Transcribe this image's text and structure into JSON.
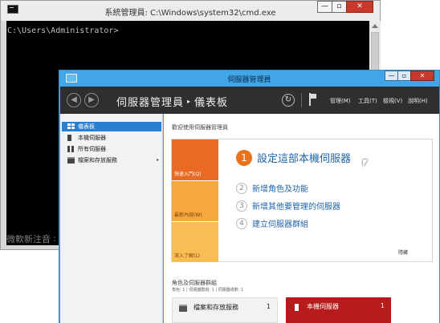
{
  "cmd": {
    "title": "系統管理員: C:\\Windows\\system32\\cmd.exe",
    "prompt": "C:\\Users\\Administrator>",
    "ime_text": "微軟新注音 ∶",
    "buttons": {
      "minimize": "—",
      "restore": "▫",
      "close": "✕"
    }
  },
  "server_manager": {
    "window_title": "伺服器管理員",
    "buttons": {
      "minimize": "—",
      "restore": "▫",
      "close": "✕"
    },
    "toolbar": {
      "back": "◀",
      "forward": "▶",
      "breadcrumb": [
        "伺服器管理員",
        "儀表板"
      ],
      "breadcrumb_separator": "▸",
      "refresh": "↻",
      "menus": {
        "manage": "管理(M)",
        "tools": "工具(T)",
        "view": "檢視(V)",
        "help": "說明(H)"
      }
    },
    "sidebar": {
      "items": [
        {
          "label": "儀表板",
          "icon": "dashboard-icon",
          "active": true
        },
        {
          "label": "本機伺服器",
          "icon": "local-server-icon"
        },
        {
          "label": "所有伺服器",
          "icon": "all-servers-icon"
        },
        {
          "label": "檔案和存放服務",
          "icon": "file-storage-icon",
          "has_arrow": true
        }
      ],
      "arrow": "▸"
    },
    "main": {
      "welcome_title": "歡迎使用伺服器管理員",
      "strips": {
        "quick_start": "快速入門(Q)",
        "whats_new": "最新內容(W)",
        "learn_more": "深入了解(L)"
      },
      "steps": [
        {
          "num": "1",
          "label": "設定這部本機伺服器"
        },
        {
          "num": "2",
          "label": "新增角色及功能"
        },
        {
          "num": "3",
          "label": "新增其他要管理的伺服器"
        },
        {
          "num": "4",
          "label": "建立伺服器群組"
        }
      ],
      "hide_label": "隱藏",
      "roles_title": "角色及伺服器群組",
      "roles_subtitle": "角色: 1 | 伺服器群組: 1 | 伺服器總數: 1",
      "tiles": [
        {
          "name": "檔案和存放服務",
          "count": "1"
        },
        {
          "name": "本機伺服器",
          "count": "1"
        }
      ]
    }
  },
  "colors": {
    "window_frame": "#41a5e8",
    "toolbar": "#2f2f2f",
    "accent_orange": "#e8731d",
    "link_blue": "#1f63a8",
    "active_blue": "#2a7fd0",
    "tile_red": "#b81b1b"
  }
}
